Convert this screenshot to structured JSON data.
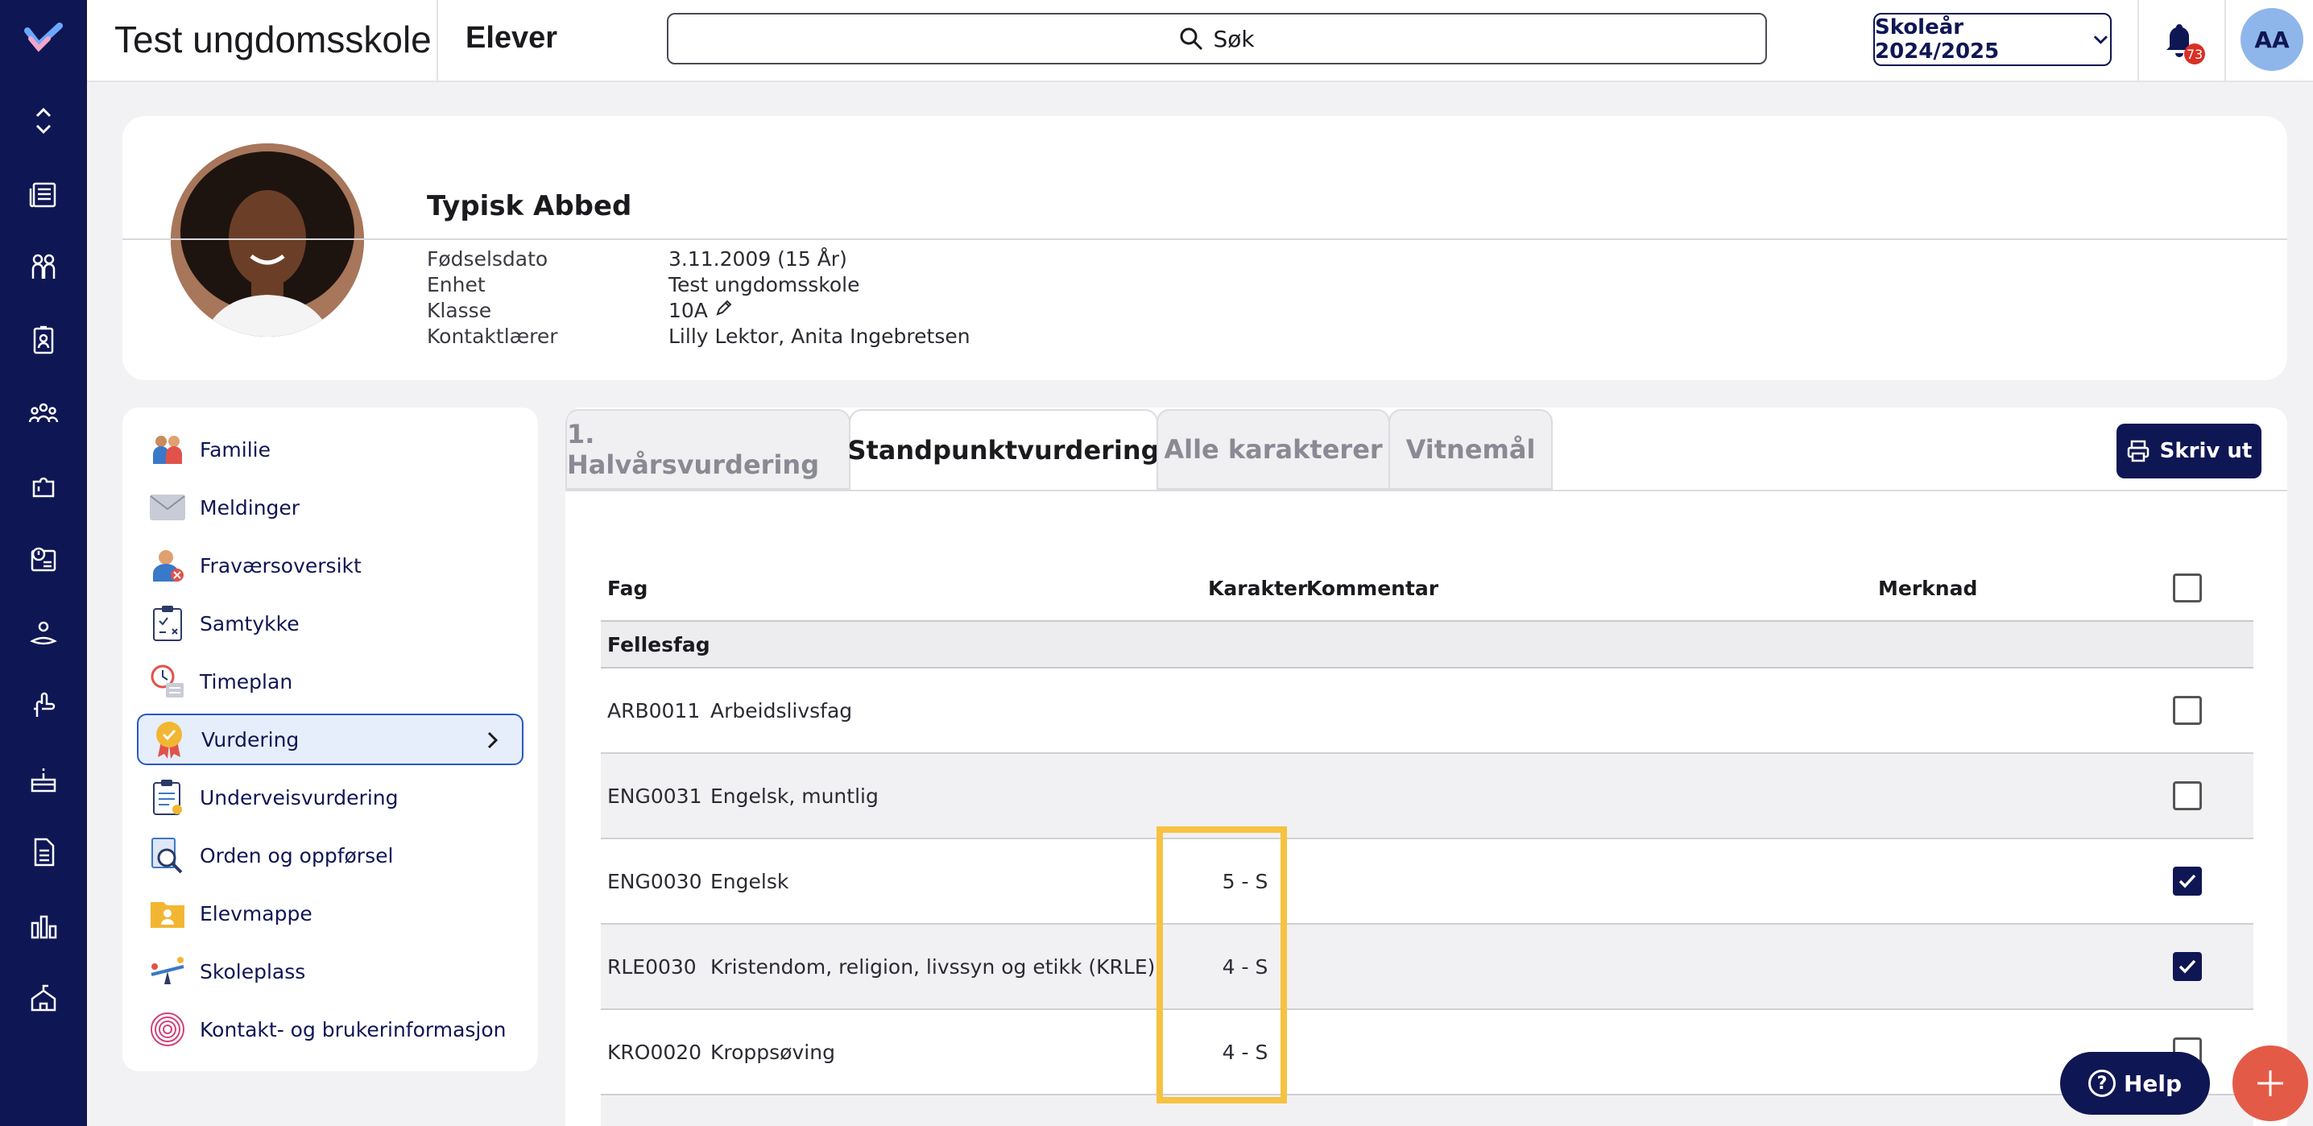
{
  "topbar": {
    "school": "Test ungdomsskole",
    "section": "Elever",
    "search_label": "Søk",
    "school_year": "Skoleår 2024/2025",
    "notification_count": "73",
    "user_initials": "AA"
  },
  "profile": {
    "name": "Typisk Abbed",
    "fields": [
      {
        "label": "Fødselsdato",
        "value": "3.11.2009 (15 År)"
      },
      {
        "label": "Enhet",
        "value": "Test ungdomsskole"
      },
      {
        "label": "Klasse",
        "value": "10A"
      },
      {
        "label": "Kontaktlærer",
        "value": "Lilly Lektor, Anita Ingebretsen"
      }
    ]
  },
  "menu": {
    "items": [
      {
        "label": "Familie",
        "icon": "family-icon"
      },
      {
        "label": "Meldinger",
        "icon": "envelope-icon"
      },
      {
        "label": "Fraværsoversikt",
        "icon": "absence-icon"
      },
      {
        "label": "Samtykke",
        "icon": "clipboard-consent-icon"
      },
      {
        "label": "Timeplan",
        "icon": "schedule-icon"
      },
      {
        "label": "Vurdering",
        "icon": "medal-icon",
        "active": true
      },
      {
        "label": "Underveisvurdering",
        "icon": "clipboard-icon"
      },
      {
        "label": "Orden og oppførsel",
        "icon": "magnifier-doc-icon"
      },
      {
        "label": "Elevmappe",
        "icon": "folder-icon"
      },
      {
        "label": "Skoleplass",
        "icon": "seesaw-icon"
      },
      {
        "label": "Kontakt- og brukerinformasjon",
        "icon": "fingerprint-icon"
      }
    ]
  },
  "tabs": [
    {
      "label": "1. Halvårsvurdering",
      "active": false
    },
    {
      "label": "Standpunktvurdering",
      "active": true
    },
    {
      "label": "Alle karakterer",
      "active": false
    },
    {
      "label": "Vitnemål",
      "active": false
    }
  ],
  "print_label": "Skriv ut",
  "table": {
    "headers": {
      "fag": "Fag",
      "karakter": "Karakter",
      "kommentar": "Kommentar",
      "merknad": "Merknad"
    },
    "group": "Fellesfag",
    "rows": [
      {
        "code": "ARB0011",
        "subject": "Arbeidslivsfag",
        "grade": "",
        "checked": false
      },
      {
        "code": "ENG0031",
        "subject": "Engelsk, muntlig",
        "grade": "",
        "checked": false
      },
      {
        "code": "ENG0030",
        "subject": "Engelsk",
        "grade": "5 - S",
        "checked": true
      },
      {
        "code": "RLE0030",
        "subject": "Kristendom, religion, livssyn og etikk (KRLE)",
        "grade": "4 - S",
        "checked": true
      },
      {
        "code": "KRO0020",
        "subject": "Kroppsøving",
        "grade": "4 - S",
        "checked": false
      }
    ]
  },
  "help_label": "Help",
  "colors": {
    "brand_navy": "#0f1654",
    "highlight": "#f6c242",
    "fab": "#e35b47",
    "badge": "#d93025"
  }
}
